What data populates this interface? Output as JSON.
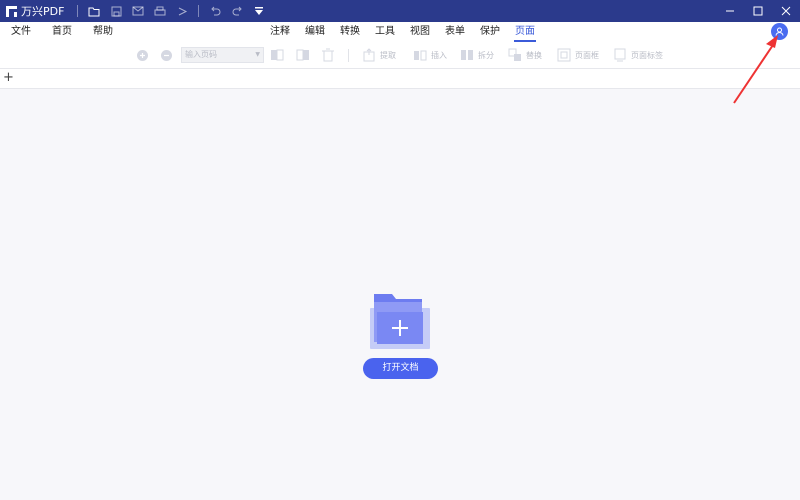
{
  "app": {
    "title": "万兴PDF"
  },
  "quick_access": [
    {
      "name": "open-folder-icon"
    },
    {
      "name": "save-icon"
    },
    {
      "name": "mail-icon"
    },
    {
      "name": "print-icon"
    },
    {
      "name": "share-icon"
    },
    {
      "name": "undo-icon"
    },
    {
      "name": "redo-icon"
    },
    {
      "name": "customize-icon"
    }
  ],
  "menu": {
    "file": "文件",
    "home": "首页",
    "help": "帮助"
  },
  "tabs": [
    {
      "label": "注释",
      "active": false
    },
    {
      "label": "编辑",
      "active": false
    },
    {
      "label": "转换",
      "active": false
    },
    {
      "label": "工具",
      "active": false
    },
    {
      "label": "视图",
      "active": false
    },
    {
      "label": "表单",
      "active": false
    },
    {
      "label": "保护",
      "active": false
    },
    {
      "label": "页面",
      "active": true
    }
  ],
  "toolbar": {
    "page_input_placeholder": "输入页码",
    "extract": "提取",
    "insert": "插入",
    "split": "拆分",
    "replace": "替换",
    "page_box": "页面框",
    "page_label": "页面标签"
  },
  "center": {
    "open_doc_label": "打开文档"
  },
  "colors": {
    "titlebar": "#2b3a8c",
    "accent": "#3b5bd9",
    "button": "#4a63ee",
    "arrow": "#ee3333"
  }
}
